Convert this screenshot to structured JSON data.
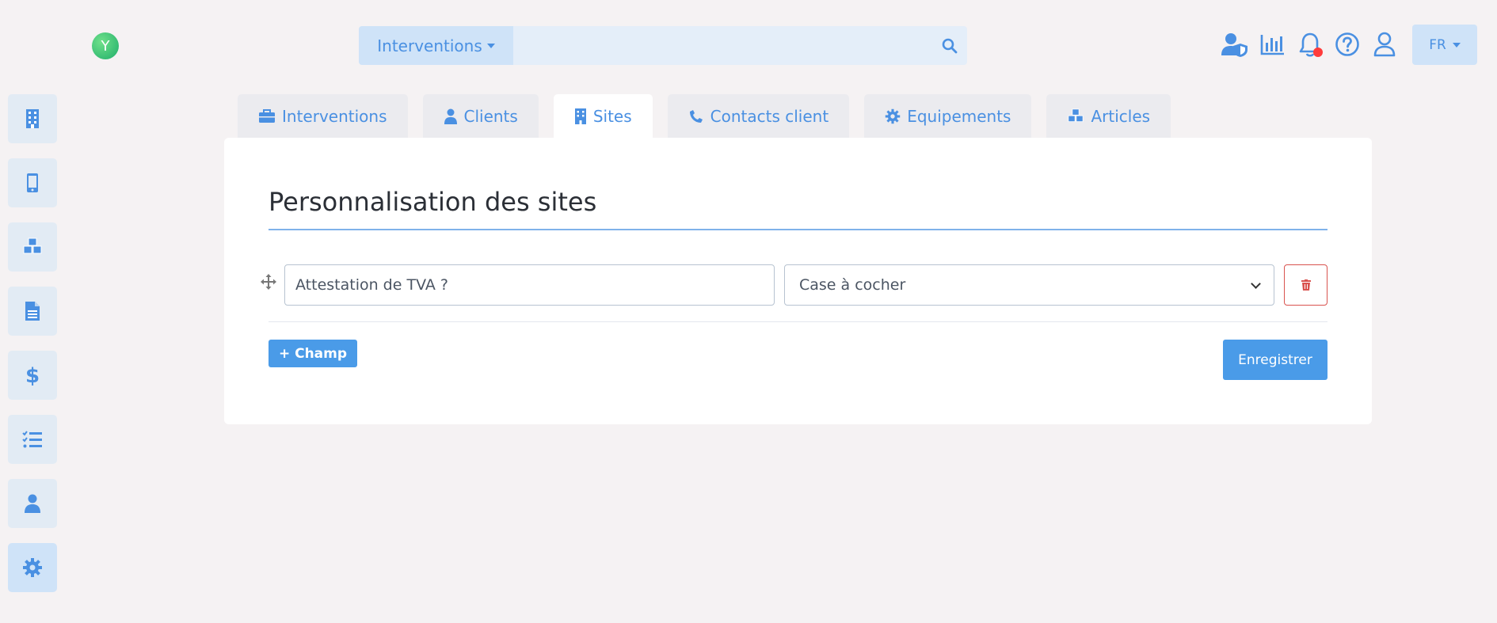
{
  "header": {
    "logo_letter": "Y",
    "search": {
      "scope_label": "Interventions",
      "value": "",
      "placeholder": ""
    },
    "icons": [
      "user-shield-icon",
      "chart-bar-icon",
      "bell-icon",
      "question-circle-icon",
      "user-icon"
    ],
    "language": "FR"
  },
  "sidebar": {
    "items": [
      {
        "icon": "building-icon"
      },
      {
        "icon": "mobile-icon"
      },
      {
        "icon": "cubes-icon"
      },
      {
        "icon": "file-icon"
      },
      {
        "icon": "dollar-icon"
      },
      {
        "icon": "tasks-icon"
      },
      {
        "icon": "user-icon"
      },
      {
        "icon": "gear-icon",
        "active": true
      }
    ]
  },
  "tabs": [
    {
      "label": "Interventions",
      "icon": "briefcase-icon"
    },
    {
      "label": "Clients",
      "icon": "user-icon"
    },
    {
      "label": "Sites",
      "icon": "building-icon",
      "active": true
    },
    {
      "label": "Contacts client",
      "icon": "phone-icon"
    },
    {
      "label": "Equipements",
      "icon": "gear-icon"
    },
    {
      "label": "Articles",
      "icon": "cubes-icon"
    }
  ],
  "main": {
    "title": "Personnalisation des sites",
    "fields": [
      {
        "name_value": "Attestation de TVA ?",
        "type_value": "Case à cocher"
      }
    ],
    "add_field_label": "+ Champ",
    "save_label": "Enregistrer"
  },
  "colors": {
    "accent": "#4a9be8",
    "danger": "#d9534f",
    "background": "#f5f2f3"
  }
}
